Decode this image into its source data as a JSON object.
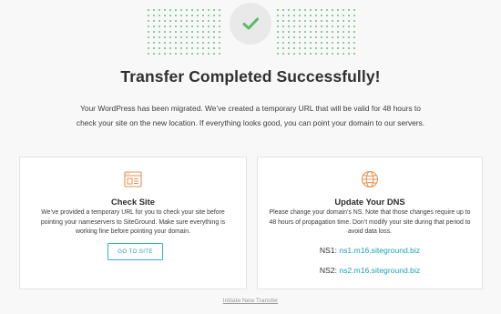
{
  "header": {
    "status_icon": "checkmark-icon",
    "title": "Transfer Completed Successfully!",
    "lead": "Your WordPress has been migrated. We’ve created a temporary URL that will be valid for 48 hours to check your site on the new location. If everything looks good, you can point your domain to our servers."
  },
  "check_site": {
    "icon": "browser-window-icon",
    "title": "Check Site",
    "text": "We’ve provided a temporary URL for you to check your site before pointing your nameservers to SiteGround. Make sure everything is working fine before pointing your domain.",
    "button_label": "GO TO SITE"
  },
  "dns": {
    "icon": "globe-icon",
    "title": "Update Your DNS",
    "text": "Please change your domain’s NS. Note that those changes require up to 48 hours of propagation time. Don’t modify your site during that period to avoid data loss.",
    "ns1_label": "NS1:",
    "ns1_value": "ns1.m16.siteground.biz",
    "ns2_label": "NS2:",
    "ns2_value": "ns2.m16.siteground.biz"
  },
  "footer": {
    "link": "Initiate New Transfer"
  },
  "colors": {
    "accent": "#1ea2b5",
    "success": "#5cb86a",
    "icon_orange": "#e7904f"
  }
}
